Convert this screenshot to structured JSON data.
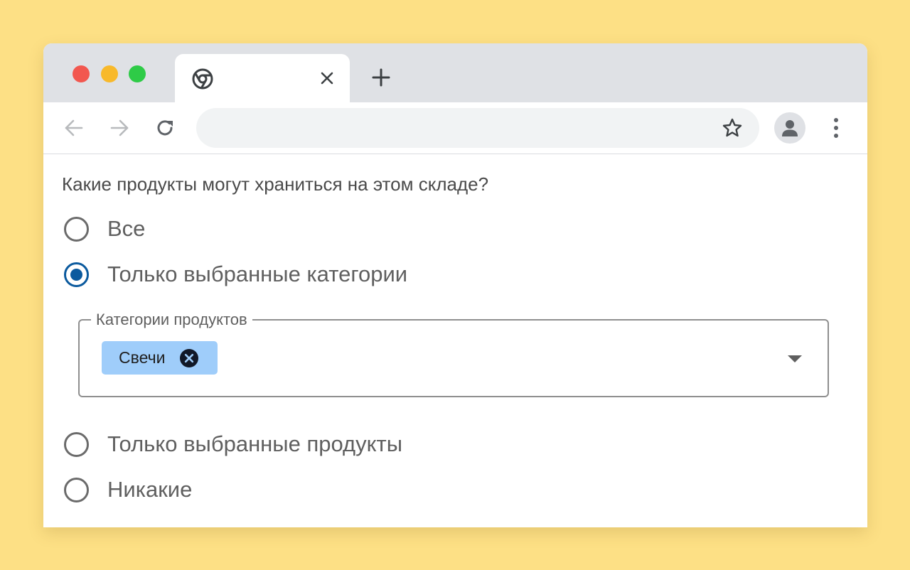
{
  "browser": {
    "tab": {
      "title": "",
      "favicon_icon": "chrome-icon",
      "close_icon": "close-icon"
    },
    "new_tab_icon": "plus-icon",
    "toolbar": {
      "back_icon": "arrow-left-icon",
      "forward_icon": "arrow-right-icon",
      "reload_icon": "reload-icon",
      "address_value": "",
      "bookmark_icon": "star-outline-icon",
      "profile_icon": "person-icon",
      "menu_icon": "more-vertical-icon"
    }
  },
  "form": {
    "question": "Какие продукты могут храниться на этом складе?",
    "options": [
      {
        "label": "Все",
        "checked": false
      },
      {
        "label": "Только выбранные категории",
        "checked": true
      },
      {
        "label": "Только выбранные продукты",
        "checked": false
      },
      {
        "label": "Никакие",
        "checked": false
      }
    ],
    "categories_field": {
      "legend": "Категории продуктов",
      "chips": [
        {
          "label": "Свечи",
          "remove_icon": "close-circle-icon"
        }
      ],
      "dropdown_icon": "caret-down-icon"
    }
  },
  "colors": {
    "page_background": "#fde085",
    "accent": "#0b5a9e",
    "chip_background": "#9fcdfa",
    "tab_strip": "#dfe1e5"
  }
}
